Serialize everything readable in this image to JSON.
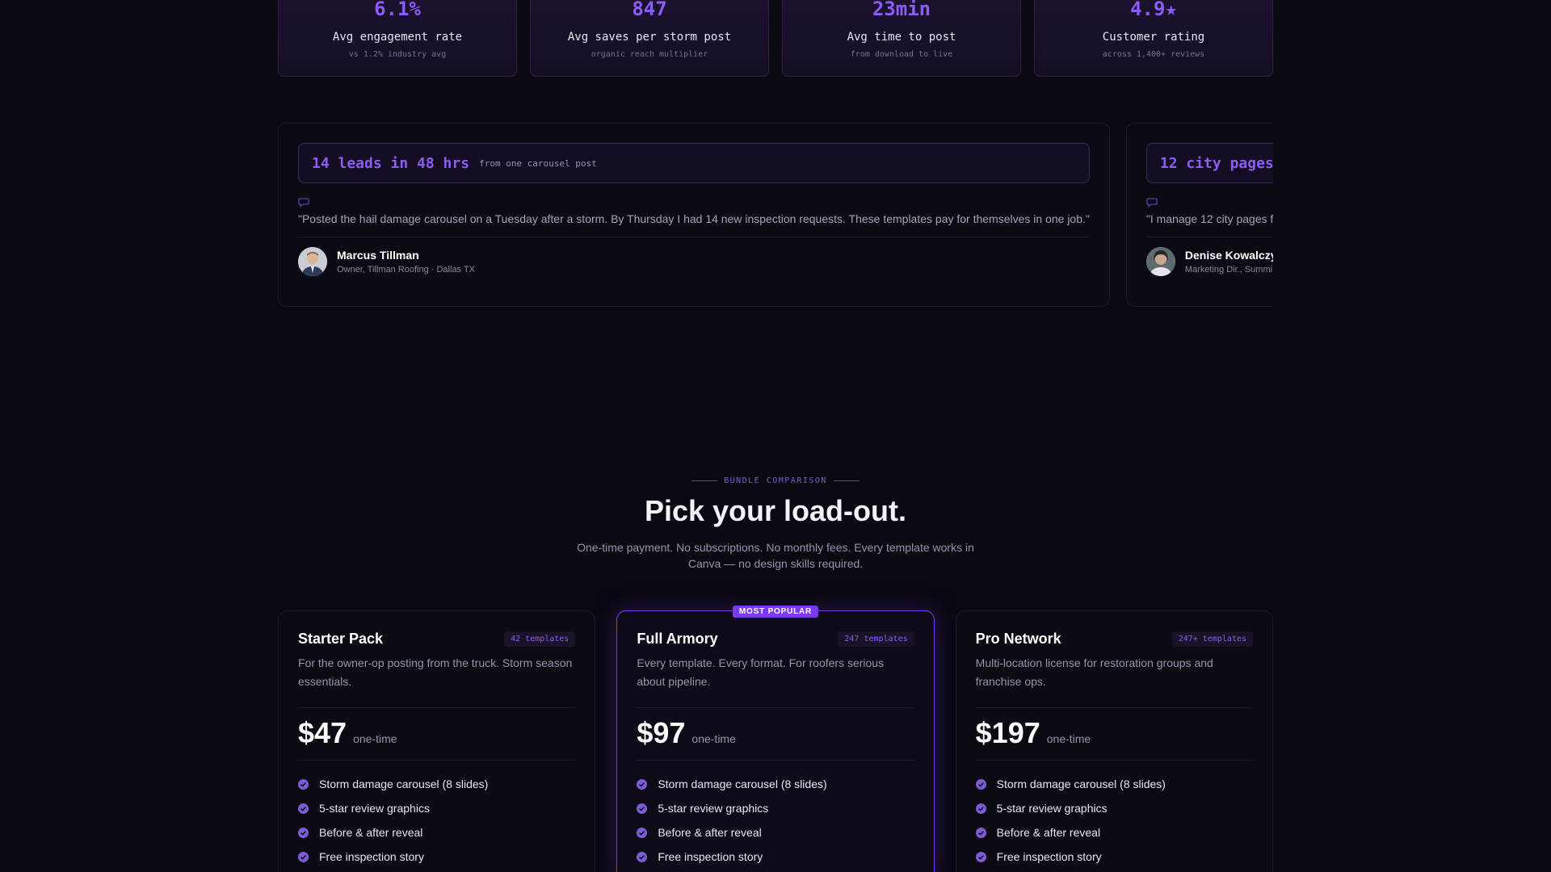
{
  "stats": [
    {
      "value": "6.1%",
      "label": "Avg engagement rate",
      "sub": "vs 1.2% industry avg"
    },
    {
      "value": "847",
      "label": "Avg saves per storm post",
      "sub": "organic reach multiplier"
    },
    {
      "value": "23min",
      "label": "Avg time to post",
      "sub": "from download to live"
    },
    {
      "value": "4.9★",
      "label": "Customer rating",
      "sub": "across 1,400+ reviews"
    }
  ],
  "testimonials": [
    {
      "headline": "14 leads in 48 hrs",
      "headline_sub": "from one carousel post",
      "quote": "\"Posted the hail damage carousel on a Tuesday after a storm. By Thursday I had 14 new inspection requests. These templates pay for themselves in one job.\"",
      "name": "Marcus Tillman",
      "role": "Owner, Tillman Roofing · Dallas TX"
    },
    {
      "headline": "12 city pages",
      "headline_sub": "",
      "quote": "\"I manage 12 city pages f",
      "name": "Denise Kowalczy",
      "role": "Marketing Dir., Summi"
    }
  ],
  "section": {
    "eyebrow": "BUNDLE COMPARISON",
    "title": "Pick your load-out.",
    "subtitle": "One-time payment. No subscriptions. No monthly fees. Every template works in Canva — no design skills required."
  },
  "plans": [
    {
      "name": "Starter Pack",
      "count": "42 templates",
      "desc": "For the owner-op posting from the truck. Storm season essentials.",
      "price": "$47",
      "term": "one-time",
      "features": [
        "Storm damage carousel (8 slides)",
        "5-star review graphics",
        "Before & after reveal",
        "Free inspection story"
      ]
    },
    {
      "name": "Full Armory",
      "count": "247 templates",
      "badge": "MOST POPULAR",
      "desc": "Every template. Every format. For roofers serious about pipeline.",
      "price": "$97",
      "term": "one-time",
      "features": [
        "Storm damage carousel (8 slides)",
        "5-star review graphics",
        "Before & after reveal",
        "Free inspection story"
      ]
    },
    {
      "name": "Pro Network",
      "count": "247+ templates",
      "desc": "Multi-location license for restoration groups and franchise ops.",
      "price": "$197",
      "term": "one-time",
      "features": [
        "Storm damage carousel (8 slides)",
        "5-star review graphics",
        "Before & after reveal",
        "Free inspection story"
      ]
    }
  ],
  "icons": {
    "quote": "quote-icon",
    "check": "check-circle-icon"
  },
  "colors": {
    "accent": "#8b5cf6",
    "accent_strong": "#7c3aed",
    "background": "#0a0810"
  }
}
